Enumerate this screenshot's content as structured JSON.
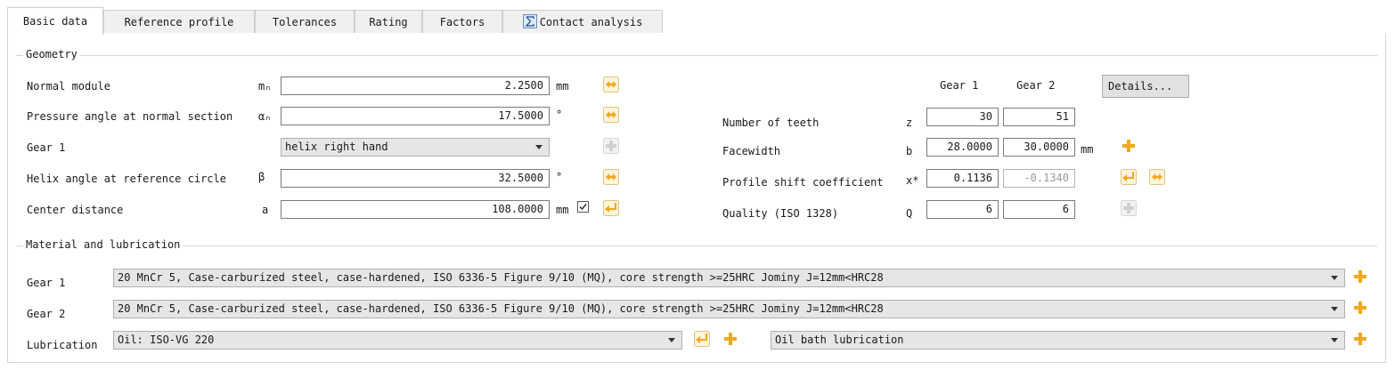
{
  "tabs": [
    {
      "label": "Basic data"
    },
    {
      "label": "Reference profile"
    },
    {
      "label": "Tolerances"
    },
    {
      "label": "Rating"
    },
    {
      "label": "Factors"
    },
    {
      "label": "Contact analysis"
    }
  ],
  "geometry": {
    "legend": "Geometry",
    "normal_module": {
      "label": "Normal module",
      "symbol": "mₙ",
      "value": "2.2500",
      "unit": "mm"
    },
    "pressure_angle": {
      "label": "Pressure angle at normal section",
      "symbol": "αₙ",
      "value": "17.5000",
      "unit": "°"
    },
    "gear1": {
      "label": "Gear 1",
      "selected": "helix right hand"
    },
    "helix_angle": {
      "label": "Helix angle at reference circle",
      "symbol": "β",
      "value": "32.5000",
      "unit": "°"
    },
    "center_distance": {
      "label": "Center distance",
      "symbol": "a",
      "value": "108.0000",
      "unit": "mm"
    },
    "col_gear1": "Gear 1",
    "col_gear2": "Gear 2",
    "details_label": "Details...",
    "teeth": {
      "label": "Number of teeth",
      "symbol": "z",
      "gear1": "30",
      "gear2": "51"
    },
    "facewidth": {
      "label": "Facewidth",
      "symbol": "b",
      "gear1": "28.0000",
      "gear2": "30.0000",
      "unit": "mm"
    },
    "profile_shift": {
      "label": "Profile shift coefficient",
      "symbol": "x*",
      "gear1": "0.1136",
      "gear2": "-0.1340"
    },
    "quality": {
      "label": "Quality (ISO 1328)",
      "symbol": "Q",
      "gear1": "6",
      "gear2": "6"
    }
  },
  "material": {
    "legend": "Material and lubrication",
    "gear1": {
      "label": "Gear 1",
      "selected": "20 MnCr 5, Case-carburized steel, case-hardened, ISO 6336-5 Figure 9/10 (MQ), core strength >=25HRC Jominy J=12mm<HRC28"
    },
    "gear2": {
      "label": "Gear 2",
      "selected": "20 MnCr 5, Case-carburized steel, case-hardened, ISO 6336-5 Figure 9/10 (MQ), core strength >=25HRC Jominy J=12mm<HRC28"
    },
    "lubrication": {
      "label": "Lubrication",
      "selected": "Oil: ISO-VG 220",
      "type_selected": "Oil bath lubrication"
    }
  },
  "colors": {
    "icon_orange": "#f0a91d",
    "icon_disabled": "#d0d0d0"
  }
}
